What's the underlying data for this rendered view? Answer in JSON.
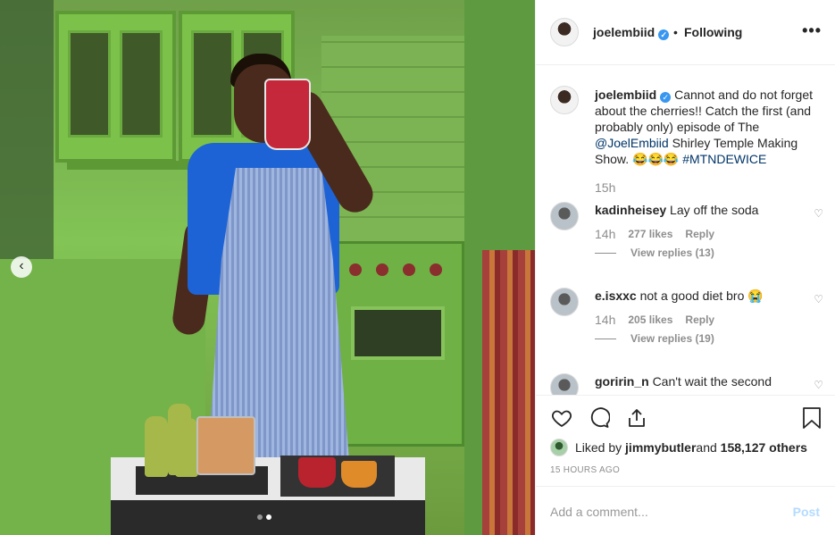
{
  "post": {
    "username": "joelembiid",
    "separator": "•",
    "follow_state": "Following",
    "more_label": "•••",
    "verified_mark": "✓",
    "carousel": {
      "slide_count": 2,
      "active_slide": 2,
      "prev_label": "‹"
    }
  },
  "caption": {
    "username": "joelembiid",
    "text_before_mention": " Cannot and do not forget about the cherries!! Catch the first (and probably only) episode of The ",
    "mention": "@JoelEmbiid",
    "text_after_mention": " Shirley Temple Making Show. 😂😂😂 ",
    "hashtag": "#MTNDEWICE",
    "time": "15h"
  },
  "comments": [
    {
      "username": "kadinheisey",
      "text": "Lay off the soda",
      "time": "14h",
      "likes": "277 likes",
      "reply_label": "Reply",
      "view_replies": "View replies (13)"
    },
    {
      "username": "e.isxxc",
      "text": "not a good diet bro 😭",
      "time": "14h",
      "likes": "205 likes",
      "reply_label": "Reply",
      "view_replies": "View replies (19)"
    },
    {
      "username": "goririn_n",
      "text": "Can't wait the second",
      "time": "",
      "likes": "",
      "reply_label": "",
      "view_replies": ""
    }
  ],
  "actions": {
    "liked_by_prefix": "Liked by ",
    "liked_by_user": "jimmybutler",
    "liked_by_middle": " and ",
    "liked_by_count": "158,127 others",
    "timestamp": "15 HOURS AGO"
  },
  "add_comment": {
    "placeholder": "Add a comment...",
    "post_label": "Post"
  },
  "icons": [
    "heart-icon",
    "comment-icon",
    "share-icon",
    "bookmark-icon",
    "more-icon",
    "chevron-left-icon"
  ],
  "colors": {
    "link": "#003569",
    "verified": "#3897f0",
    "muted": "#8e8e8e",
    "post_disabled": "#b3dbff"
  }
}
